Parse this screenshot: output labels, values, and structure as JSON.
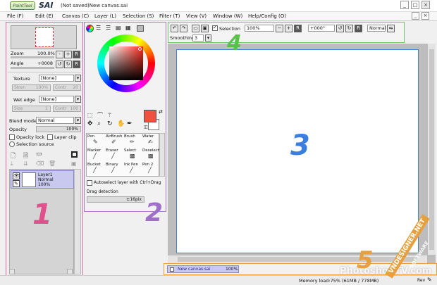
{
  "titlebar": {
    "logo_text": "PaintTool",
    "app_name": "SAI",
    "window_title": "(Not saved)New canvas.sai",
    "min_label": "_",
    "max_label": "□",
    "close_label": "×"
  },
  "menu": {
    "items": [
      "File (F)",
      "Edit (E)",
      "Canvas (C)",
      "Layer (L)",
      "Selection (S)",
      "Filter (T)",
      "View (V)",
      "Window (W)",
      "Help/Config (O)"
    ],
    "right_min": "_",
    "right_close": "×"
  },
  "navigator": {
    "zoom_label": "Zoom",
    "zoom_value": "100.0%",
    "angle_label": "Angle",
    "angle_value": "+0008",
    "btn_minus": "-",
    "btn_plus": "+",
    "btn_reset": "R"
  },
  "layer_props": {
    "texture_label": "Texture",
    "texture_value": "[None]",
    "strength_label": "Stren",
    "strength_value": "100%",
    "contrast_label": "Contr",
    "contrast_value": "20",
    "wet_label": "Wet edge",
    "wet_value": "[None]",
    "size_label": "Size",
    "size_value": "1",
    "contr2_value": "100",
    "blend_label": "Blend mode",
    "blend_value": "Normal",
    "opacity_label": "Opacity",
    "opacity_value": "100%",
    "opacity_lock_label": "Opacity lock",
    "layer_clip_label": "Layer clip",
    "selection_source_label": "Selection source"
  },
  "layers": [
    {
      "name": "Layer1",
      "mode": "Normal",
      "opacity": "100%"
    }
  ],
  "tools": [
    {
      "name": "Pen",
      "icon": "pen-icon"
    },
    {
      "name": "AirBrush",
      "icon": "airbrush-icon"
    },
    {
      "name": "Brush",
      "icon": "brush-icon"
    },
    {
      "name": "Water",
      "icon": "water-icon"
    },
    {
      "name": "Marker",
      "icon": "marker-icon"
    },
    {
      "name": "Eraser",
      "icon": "eraser-icon"
    },
    {
      "name": "Select",
      "icon": "select-icon"
    },
    {
      "name": "Deselect",
      "icon": "deselect-icon"
    },
    {
      "name": "Bucket",
      "icon": "bucket-icon"
    },
    {
      "name": "Binary",
      "icon": "binary-icon"
    },
    {
      "name": "Ink Pen",
      "icon": "inkpen-icon"
    },
    {
      "name": "Pen 2",
      "icon": "pen-icon"
    }
  ],
  "tool_options": {
    "autoselect_label": "Autoselect layer with Ctrl+Drag",
    "drag_label": "Drag detection",
    "drag_value": "±16pix"
  },
  "top_toolbar": {
    "selection_label": "Selection",
    "zoom_value": "100%",
    "angle_value": "+000°",
    "blend_value": "Normal",
    "smoothing_label": "Smoothing",
    "smoothing_value": "3"
  },
  "canvas_tabs": [
    {
      "name": "New canvas.sai",
      "zoom": "100%"
    }
  ],
  "status": {
    "memory": "Memory load:75% (61MB / 778MB)",
    "lock_label": "Rev"
  },
  "annotations": [
    "1",
    "2",
    "3",
    "4",
    "5"
  ],
  "watermarks": [
    "PhotoshopTV.com",
    "VNDESIGNER.NET",
    "SOFTWARE"
  ],
  "colors": {
    "primary": "#f05040",
    "secondary": "#ffffff",
    "ann_1": "#e0508a",
    "ann_2": "#a070c8",
    "ann_3": "#3a7ee0",
    "ann_4": "#5cbf4a",
    "ann_5": "#e6a040"
  }
}
